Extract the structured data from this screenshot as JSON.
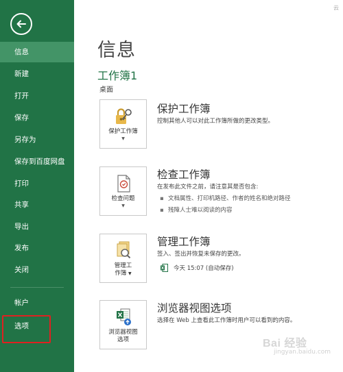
{
  "sidebar": {
    "items": [
      {
        "label": "信息"
      },
      {
        "label": "新建"
      },
      {
        "label": "打开"
      },
      {
        "label": "保存"
      },
      {
        "label": "另存为"
      },
      {
        "label": "保存到百度网盘"
      },
      {
        "label": "打印"
      },
      {
        "label": "共享"
      },
      {
        "label": "导出"
      },
      {
        "label": "发布"
      },
      {
        "label": "关闭"
      },
      {
        "label": "帐户"
      },
      {
        "label": "选项"
      }
    ]
  },
  "page": {
    "title": "信息",
    "workbook_name": "工作簿1",
    "workbook_location": "桌面",
    "top_right": "云"
  },
  "sections": {
    "protect": {
      "tile_label": "保护工作簿",
      "title": "保护工作簿",
      "description": "控制其他人可以对此工作簿所做的更改类型。"
    },
    "inspect": {
      "tile_label": "检查问题",
      "title": "检查工作簿",
      "description": "在发布此文件之前，请注意其是否包含:",
      "bullets": [
        "文档属性、打印机路径、作者的姓名和绝对路径",
        "残障人士难以阅读的内容"
      ]
    },
    "manage": {
      "tile_label_1": "管理工",
      "tile_label_2": "作簿",
      "title": "管理工作簿",
      "description": "签入、签出并恢复未保存的更改。",
      "saved_entry": "今天 15:07 (自动保存)"
    },
    "browser": {
      "tile_label_1": "浏览器视图",
      "tile_label_2": "选项",
      "title": "浏览器视图选项",
      "description": "选择在 Web 上查看此工作簿时用户可以看到的内容。"
    }
  },
  "watermark": {
    "main": "Bai 经验",
    "sub": "jingyan.baidu.com"
  },
  "colors": {
    "sidebar": "#217346",
    "sidebar_active": "#439467",
    "highlight": "#e02020"
  }
}
